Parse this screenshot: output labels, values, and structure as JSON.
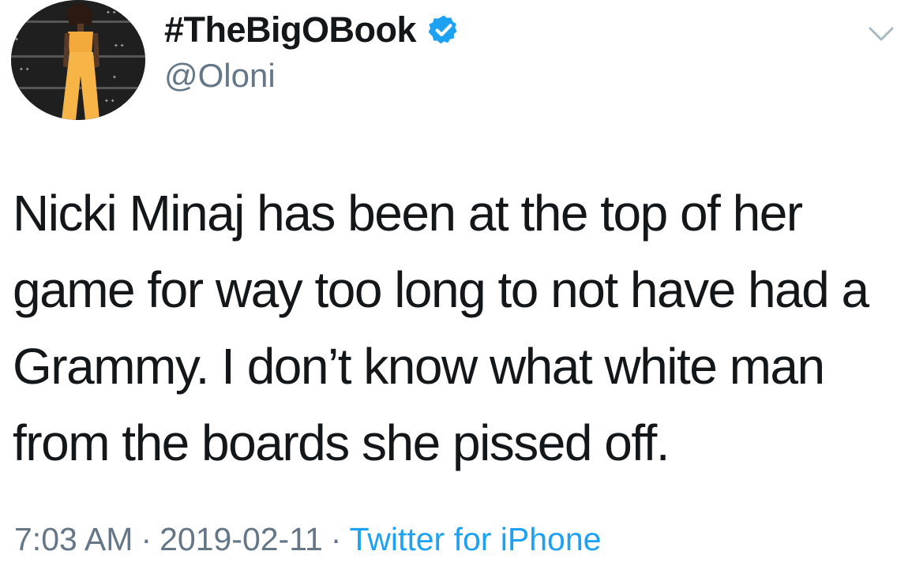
{
  "tweet": {
    "display_name": "#TheBigOBook",
    "handle": "@Oloni",
    "verified": true,
    "text": "Nicki Minaj has been at the top of her game for way too long to not have had a Grammy. I don’t know what white man from the boards she pissed off.",
    "time": "7:03 AM",
    "separator": "·",
    "date": "2019-02-11",
    "source": "Twitter for iPhone",
    "avatar_icon": "profile-photo",
    "menu_icon": "chevron-down-icon"
  },
  "colors": {
    "text": "#14171a",
    "secondary": "#657786",
    "link": "#1da1f2",
    "verified_badge": "#1da1f2",
    "chevron": "#aab8c2"
  }
}
